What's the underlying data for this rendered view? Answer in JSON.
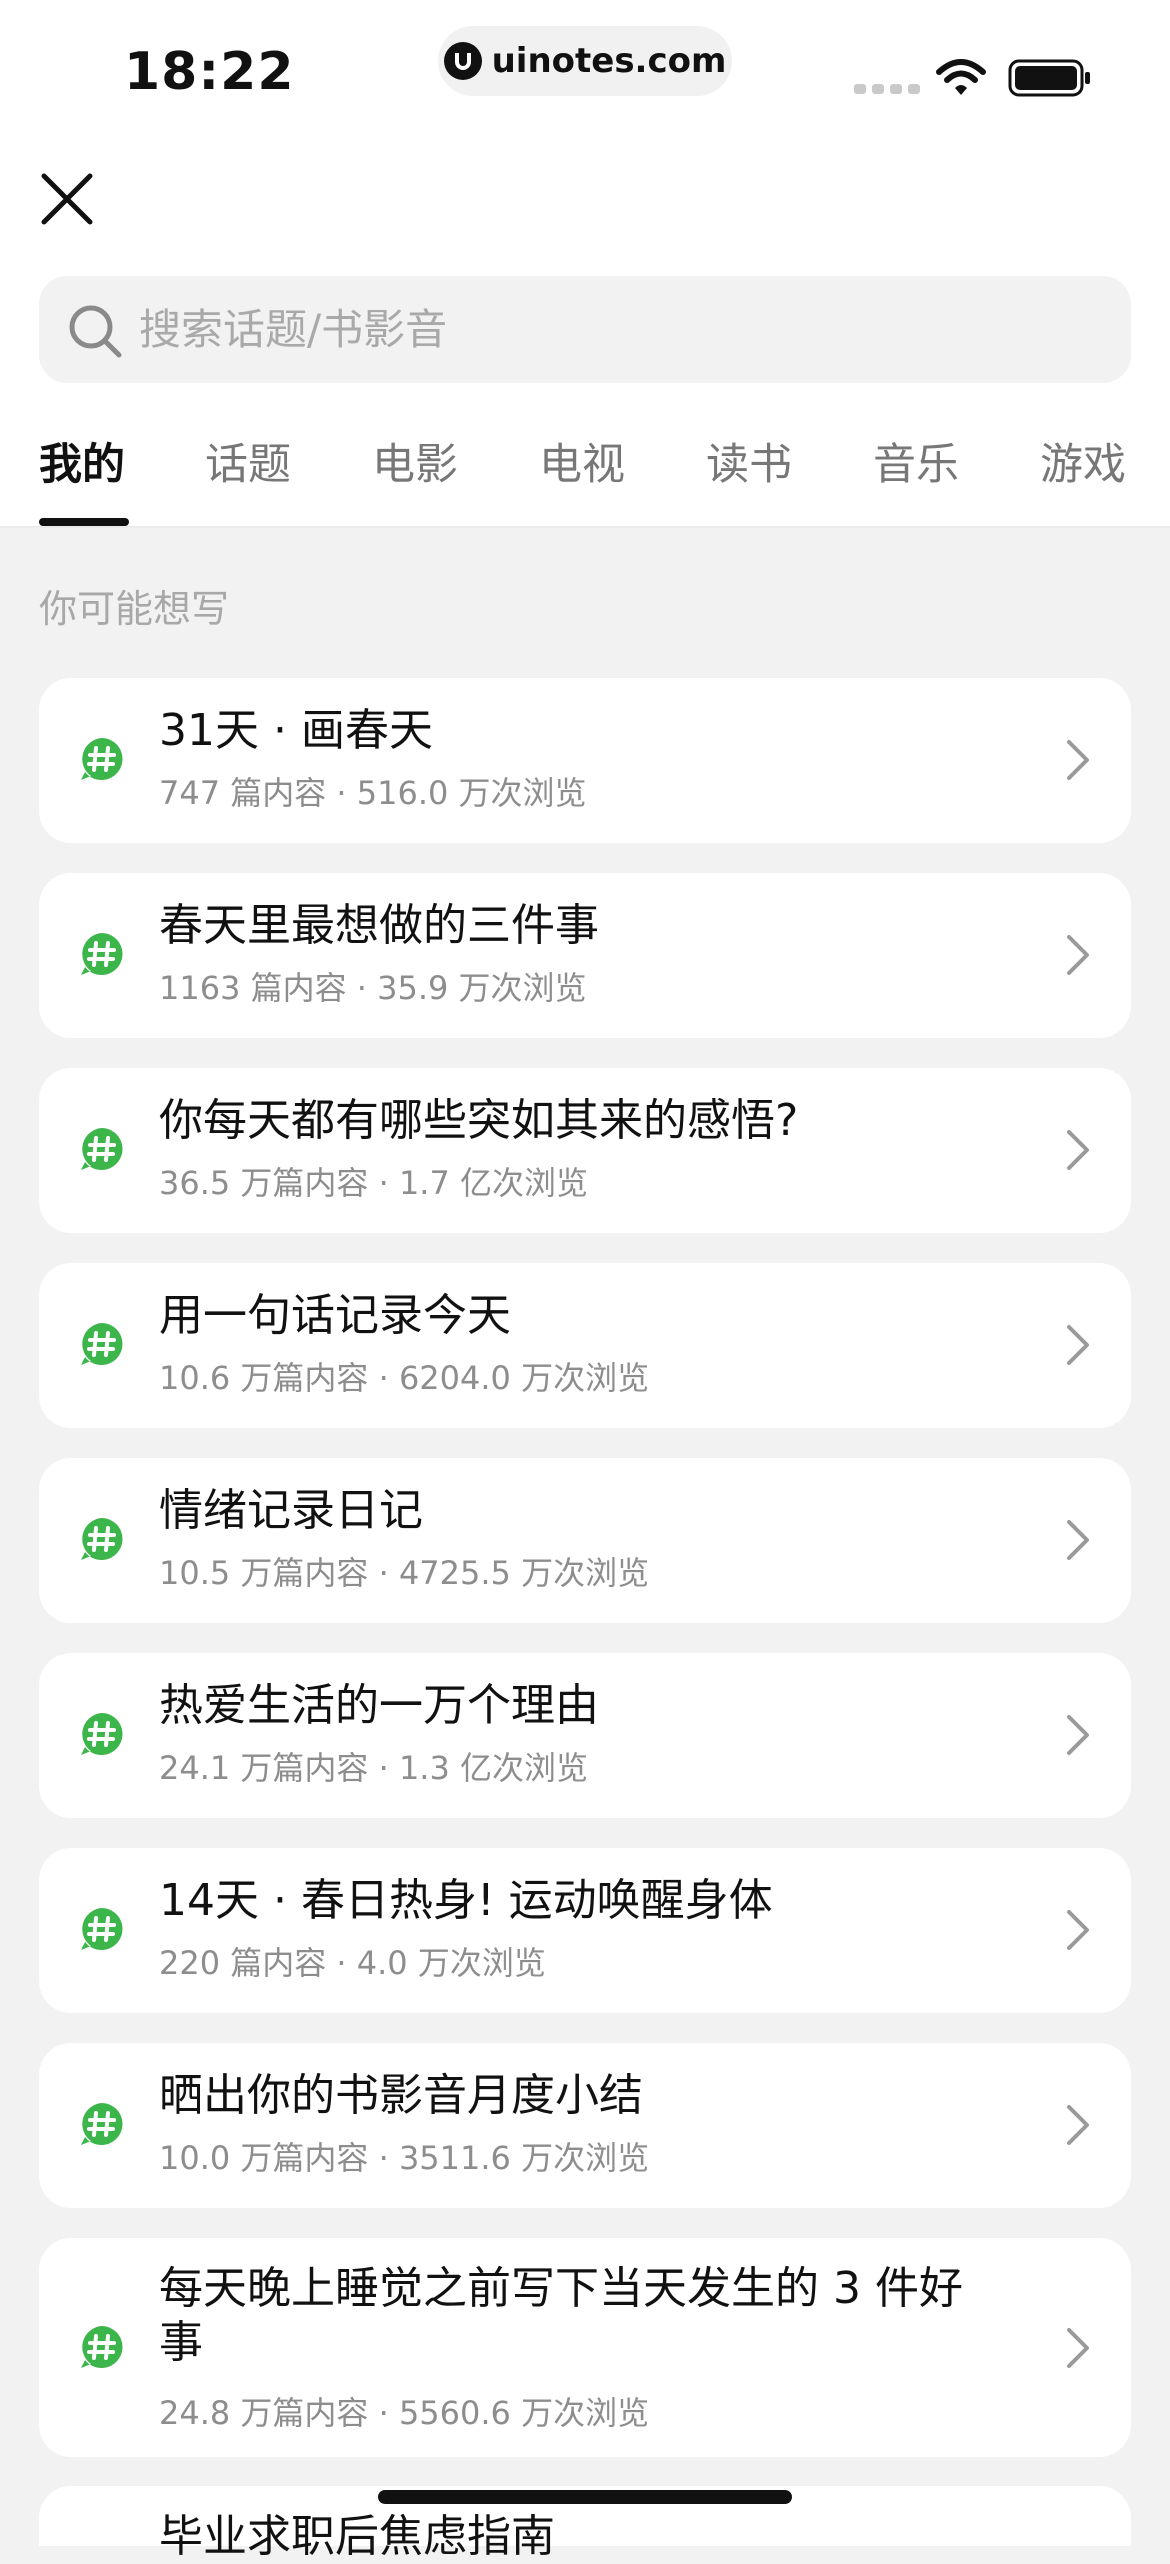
{
  "status_bar": {
    "time": "18:22",
    "url": "uinotes.com"
  },
  "search": {
    "placeholder": "搜索话题/书影音"
  },
  "tabs": [
    {
      "label": "我的",
      "active": true
    },
    {
      "label": "话题"
    },
    {
      "label": "电影"
    },
    {
      "label": "电视"
    },
    {
      "label": "读书"
    },
    {
      "label": "音乐"
    },
    {
      "label": "游戏"
    }
  ],
  "section_label": "你可能想写",
  "topics": [
    {
      "title": "31天 · 画春天",
      "meta": "747 篇内容 · 516.0 万次浏览"
    },
    {
      "title": "春天里最想做的三件事",
      "meta": "1163 篇内容 · 35.9 万次浏览"
    },
    {
      "title": "你每天都有哪些突如其来的感悟?",
      "meta": "36.5 万篇内容 · 1.7 亿次浏览"
    },
    {
      "title": "用一句话记录今天",
      "meta": "10.6 万篇内容 · 6204.0 万次浏览"
    },
    {
      "title": "情绪记录日记",
      "meta": "10.5 万篇内容 · 4725.5 万次浏览"
    },
    {
      "title": "热爱生活的一万个理由",
      "meta": "24.1 万篇内容 · 1.3 亿次浏览"
    },
    {
      "title": "14天 · 春日热身! 运动唤醒身体",
      "meta": "220 篇内容 · 4.0 万次浏览"
    },
    {
      "title": "晒出你的书影音月度小结",
      "meta": "10.0 万篇内容 · 3511.6 万次浏览"
    },
    {
      "title": "每天晚上睡觉之前写下当天发生的 3 件好事",
      "meta": "24.8 万篇内容 · 5560.6 万次浏览"
    }
  ],
  "peek_title": "毕业求职后焦虑指南",
  "colors": {
    "accent_green": "#3cb54a",
    "active_tab": "#111111",
    "muted_text": "#8d8d8d"
  }
}
